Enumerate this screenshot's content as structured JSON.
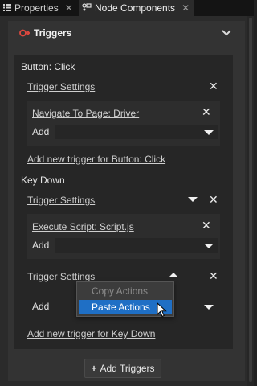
{
  "tabs": [
    {
      "label": "Properties",
      "active": false
    },
    {
      "label": "Node Components",
      "active": true
    }
  ],
  "section": {
    "title": "Triggers"
  },
  "groups": [
    {
      "name": "Button: Click",
      "trigger_settings_label": "Trigger Settings",
      "action": "Navigate To Page: Driver",
      "add_label": "Add",
      "add_trigger_link": "Add new trigger for Button: Click"
    },
    {
      "name": "Key Down",
      "trigger_settings_label": "Trigger Settings",
      "action": "Execute Script: Script.js",
      "add_label": "Add",
      "trigger_settings_label_2": "Trigger Settings",
      "add_label_2": "Add",
      "add_trigger_link": "Add new trigger for Key Down"
    }
  ],
  "context_menu": {
    "items": [
      {
        "label": "Copy Actions",
        "enabled": false
      },
      {
        "label": "Paste Actions",
        "enabled": true,
        "highlighted": true
      }
    ]
  },
  "add_triggers_button": "Add Triggers",
  "colors": {
    "accent": "#1f6fc5",
    "trigger_icon": "#e0483f"
  }
}
